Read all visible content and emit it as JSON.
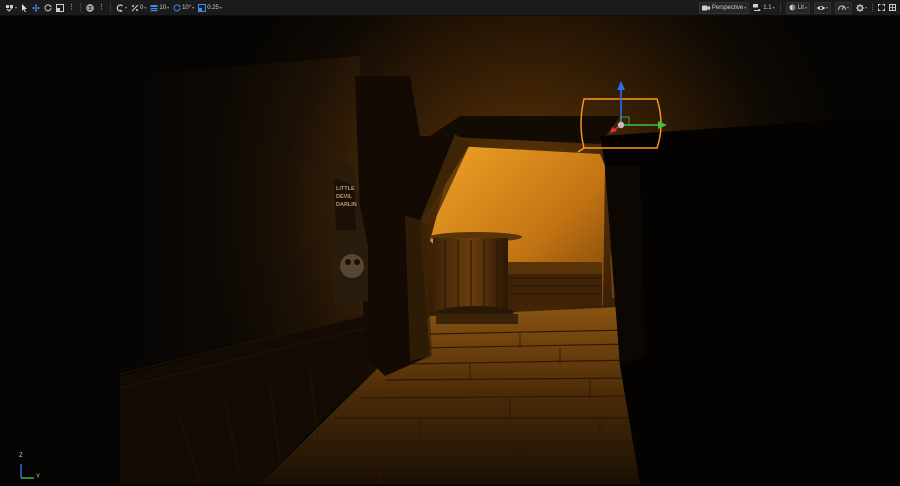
{
  "toolbar": {
    "left": {
      "transform_select_icon": "select-mode-icon",
      "grid_snap_value": "0",
      "translate_snap_value": "10",
      "rotate_snap_value": "10°",
      "scale_snap_value": "0.25"
    },
    "right": {
      "view_mode_label": "Perspective",
      "camera_speed_label": "1.1",
      "lighting_mode_label": "Lit"
    }
  },
  "axis_gizmo": {
    "z_label": "Z",
    "y_label": "Y"
  },
  "colors": {
    "toolbar_bg": "#1b1b1b",
    "accent_blue": "#3d8ee6",
    "selection_outline": "#ff9a1f",
    "warm_light": "#f0a326"
  },
  "poster": {
    "line1": "LITTLE",
    "line2": "DEVIL",
    "line3": "DARLIN"
  }
}
